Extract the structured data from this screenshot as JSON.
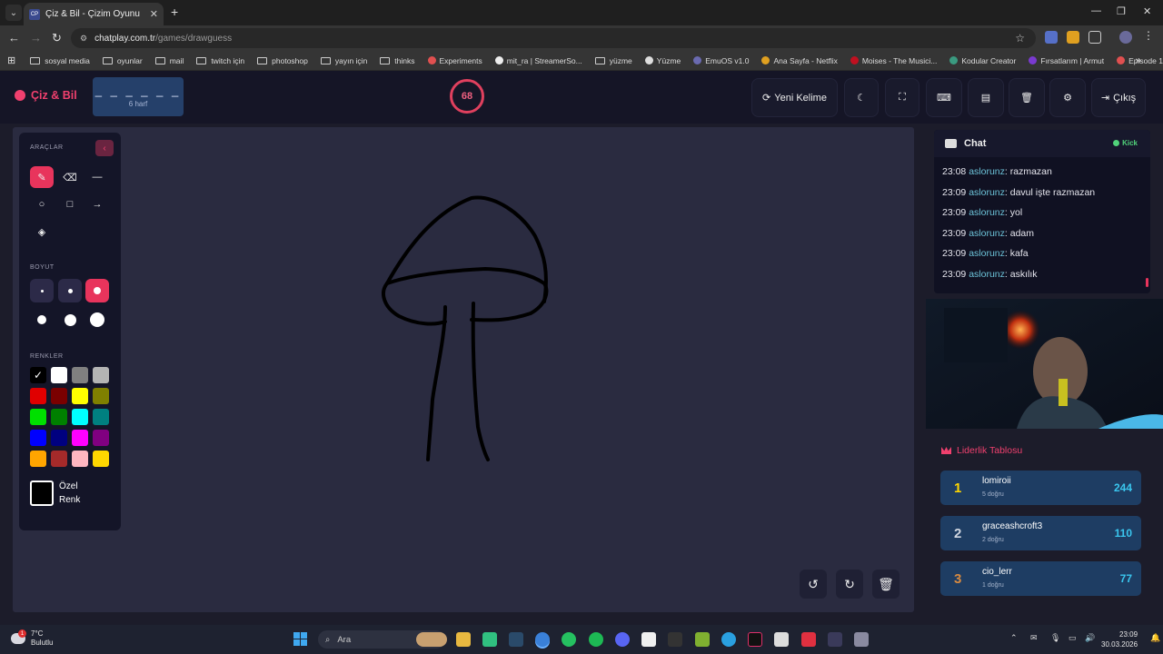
{
  "browser": {
    "tab_title": "Çiz & Bil - Çizim Oyunu",
    "tab_favicon": "CP",
    "url_host": "chatplay.com.tr",
    "url_path": "/games/drawguess",
    "bookmarks": [
      "sosyal media",
      "oyunlar",
      "mail",
      "twitch için",
      "photoshop",
      "yayın için",
      "thinks",
      "Experiments",
      "mit_ra | StreamerSo...",
      "yüzme",
      "Yüzme",
      "EmuOS v1.0",
      "Ana Sayfa - Netflix",
      "Moises - The Musici...",
      "Kodular Creator",
      "Fırsatlarım | Armut",
      "Episode 1 • Max"
    ]
  },
  "header": {
    "logo": "Çiz & Bil",
    "word_blanks": "_ _ _ _ _ _",
    "word_length": "6 harf",
    "timer": "68",
    "new_word": "Yeni Kelime",
    "exit": "Çıkış"
  },
  "tools": {
    "tools_label": "ARAÇLAR",
    "size_label": "BOYUT",
    "colors_label": "RENKLER",
    "custom_color_label": "Özel Renk",
    "colors": [
      "#000000",
      "#ffffff",
      "#808080",
      "#b4b4b4",
      "#e00000",
      "#7a0000",
      "#ffff00",
      "#808000",
      "#00e000",
      "#008000",
      "#00ffff",
      "#008080",
      "#0000ff",
      "#000080",
      "#ff00ff",
      "#800080",
      "#ffa500",
      "#a52a2a",
      "#ffb6c1",
      "#ffd700"
    ]
  },
  "chat": {
    "title": "Chat",
    "platform": "Kick",
    "messages": [
      {
        "time": "23:08",
        "user": "aslorunz",
        "text": "razmazan"
      },
      {
        "time": "23:09",
        "user": "aslorunz",
        "text": "davul işte razmazan"
      },
      {
        "time": "23:09",
        "user": "aslorunz",
        "text": "yol"
      },
      {
        "time": "23:09",
        "user": "aslorunz",
        "text": "adam"
      },
      {
        "time": "23:09",
        "user": "aslorunz",
        "text": "kafa"
      },
      {
        "time": "23:09",
        "user": "aslorunz",
        "text": "askılık"
      }
    ]
  },
  "leaderboard": {
    "title": "Liderlik Tablosu",
    "rows": [
      {
        "rank": "1",
        "name": "lomiroii",
        "sub": "5 doğru",
        "score": "244",
        "color": "#ffd700"
      },
      {
        "rank": "2",
        "name": "graceashcroft3",
        "sub": "2 doğru",
        "score": "110",
        "color": "#d0d6e0"
      },
      {
        "rank": "3",
        "name": "cio_lerr",
        "sub": "1 doğru",
        "score": "77",
        "color": "#d88a40"
      }
    ]
  },
  "taskbar": {
    "weather_temp": "7°C",
    "weather_desc": "Bulutlu",
    "weather_badge": "1",
    "search": "Ara",
    "time": "23:09",
    "date": "30.03.2026"
  }
}
